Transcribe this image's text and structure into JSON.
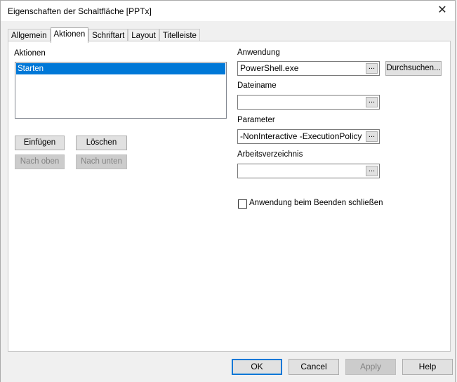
{
  "window": {
    "title": "Eigenschaften der Schaltfläche [PPTx]",
    "close_glyph": "✕"
  },
  "tabs": [
    {
      "label": "Allgemein"
    },
    {
      "label": "Aktionen"
    },
    {
      "label": "Schriftart"
    },
    {
      "label": "Layout"
    },
    {
      "label": "Titelleiste"
    }
  ],
  "actions": {
    "label": "Aktionen",
    "items": [
      "Starten"
    ],
    "insert_label": "Einfügen",
    "delete_label": "Löschen",
    "up_label": "Nach oben",
    "down_label": "Nach unten"
  },
  "fields": {
    "application": {
      "label": "Anwendung",
      "value": "PowerShell.exe",
      "browse_label": "Durchsuchen..."
    },
    "filename": {
      "label": "Dateiname",
      "value": ""
    },
    "parameter": {
      "label": "Parameter",
      "value": "-NonInteractive -ExecutionPolicy"
    },
    "workdir": {
      "label": "Arbeitsverzeichnis",
      "value": ""
    },
    "ellipsis": "..."
  },
  "close_on_exit": {
    "label": "Anwendung beim Beenden schließen",
    "checked": false
  },
  "footer": {
    "ok": "OK",
    "cancel": "Cancel",
    "apply": "Apply",
    "help": "Help"
  }
}
